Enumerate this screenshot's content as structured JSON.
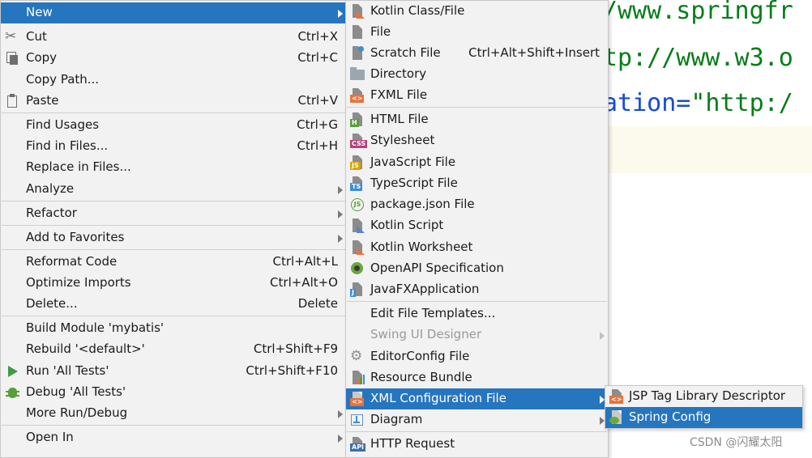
{
  "editor": {
    "line1": "/www.springfr",
    "line2": "tp://www.w3.o",
    "line3_attr": "ation=",
    "line3_str": "\"http:/"
  },
  "watermark": "CSDN @闪耀太阳",
  "context_menu": {
    "items": [
      {
        "label": "New",
        "shortcut": "",
        "submenu": true,
        "icon": "none"
      },
      {
        "label": "Cut",
        "shortcut": "Ctrl+X",
        "icon": "scissors-icon"
      },
      {
        "label": "Copy",
        "shortcut": "Ctrl+C",
        "icon": "copy-icon"
      },
      {
        "label": "Copy Path...",
        "shortcut": "",
        "icon": "none"
      },
      {
        "label": "Paste",
        "shortcut": "Ctrl+V",
        "icon": "clipboard-icon"
      },
      {
        "label": "Find Usages",
        "shortcut": "Ctrl+G"
      },
      {
        "label": "Find in Files...",
        "shortcut": "Ctrl+H"
      },
      {
        "label": "Replace in Files...",
        "shortcut": ""
      },
      {
        "label": "Analyze",
        "shortcut": "",
        "submenu": true
      },
      {
        "label": "Refactor",
        "shortcut": "",
        "submenu": true
      },
      {
        "label": "Add to Favorites",
        "shortcut": "",
        "submenu": true
      },
      {
        "label": "Reformat Code",
        "shortcut": "Ctrl+Alt+L"
      },
      {
        "label": "Optimize Imports",
        "shortcut": "Ctrl+Alt+O"
      },
      {
        "label": "Delete...",
        "shortcut": "Delete"
      },
      {
        "label": "Build Module 'mybatis'",
        "shortcut": ""
      },
      {
        "label": "Rebuild '<default>'",
        "shortcut": "Ctrl+Shift+F9"
      },
      {
        "label": "Run 'All Tests'",
        "shortcut": "Ctrl+Shift+F10",
        "icon": "run-icon"
      },
      {
        "label": "Debug 'All Tests'",
        "shortcut": "",
        "icon": "debug-icon"
      },
      {
        "label": "More Run/Debug",
        "shortcut": "",
        "submenu": true
      },
      {
        "label": "Open In",
        "shortcut": "",
        "submenu": true
      }
    ]
  },
  "new_submenu": {
    "items": [
      {
        "label": "Kotlin Class/File",
        "icon": "kotlin-file-icon"
      },
      {
        "label": "File",
        "icon": "file-icon"
      },
      {
        "label": "Scratch File",
        "shortcut": "Ctrl+Alt+Shift+Insert",
        "icon": "scratch-file-icon"
      },
      {
        "label": "Directory",
        "icon": "folder-icon"
      },
      {
        "label": "FXML File",
        "icon": "fxml-file-icon"
      },
      {
        "label": "HTML File",
        "icon": "html-file-icon"
      },
      {
        "label": "Stylesheet",
        "icon": "css-file-icon"
      },
      {
        "label": "JavaScript File",
        "icon": "js-file-icon"
      },
      {
        "label": "TypeScript File",
        "icon": "ts-file-icon"
      },
      {
        "label": "package.json File",
        "icon": "nodejs-icon"
      },
      {
        "label": "Kotlin Script",
        "icon": "kotlin-script-icon"
      },
      {
        "label": "Kotlin Worksheet",
        "icon": "kotlin-worksheet-icon"
      },
      {
        "label": "OpenAPI Specification",
        "icon": "openapi-icon"
      },
      {
        "label": "JavaFXApplication",
        "icon": "javafx-icon"
      },
      {
        "label": "Edit File Templates...",
        "icon": "none"
      },
      {
        "label": "Swing UI Designer",
        "icon": "none",
        "disabled": true,
        "submenu": true
      },
      {
        "label": "EditorConfig File",
        "icon": "gear-icon"
      },
      {
        "label": "Resource Bundle",
        "icon": "resource-bundle-icon"
      },
      {
        "label": "XML Configuration File",
        "icon": "xml-file-icon",
        "submenu": true,
        "selected": true
      },
      {
        "label": "Diagram",
        "icon": "diagram-icon",
        "submenu": true
      },
      {
        "label": "HTTP Request",
        "icon": "api-icon"
      }
    ]
  },
  "xml_submenu": {
    "items": [
      {
        "label": "JSP Tag Library Descriptor",
        "icon": "xml-file-icon"
      },
      {
        "label": "Spring Config",
        "icon": "spring-config-icon",
        "selected": true
      }
    ]
  },
  "colors": {
    "selection": "#2675bf",
    "menu_bg": "#f2f2f2",
    "code_green": "#067d17",
    "code_blue": "#174ad4"
  }
}
